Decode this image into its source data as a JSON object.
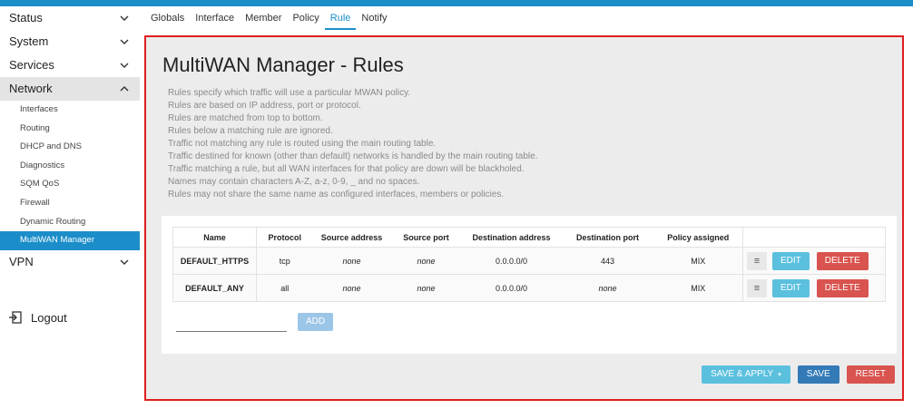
{
  "colors": {
    "accent": "#1b8ec9",
    "highlight_border": "#e01e1e",
    "edit": "#5bc0de",
    "delete": "#d9534f",
    "save": "#337ab7"
  },
  "sidebar": {
    "menus": [
      {
        "label": "Status",
        "icon": "chevron-down-icon"
      },
      {
        "label": "System",
        "icon": "chevron-down-icon"
      },
      {
        "label": "Services",
        "icon": "chevron-down-icon"
      },
      {
        "label": "Network",
        "icon": "chevron-up-icon"
      }
    ],
    "network_items": [
      "Interfaces",
      "Routing",
      "DHCP and DNS",
      "Diagnostics",
      "SQM QoS",
      "Firewall",
      "Dynamic Routing",
      "MultiWAN Manager"
    ],
    "vpn": {
      "label": "VPN",
      "icon": "chevron-down-icon"
    },
    "logout": {
      "label": "Logout",
      "icon": "logout-icon"
    }
  },
  "tabs": [
    "Globals",
    "Interface",
    "Member",
    "Policy",
    "Rule",
    "Notify"
  ],
  "page": {
    "title": "MultiWAN Manager - Rules",
    "description": [
      "Rules specify which traffic will use a particular MWAN policy.",
      "Rules are based on IP address, port or protocol.",
      "Rules are matched from top to bottom.",
      "Rules below a matching rule are ignored.",
      "Traffic not matching any rule is routed using the main routing table.",
      "Traffic destined for known (other than default) networks is handled by the main routing table.",
      "Traffic matching a rule, but all WAN interfaces for that policy are down will be blackholed.",
      "Names may contain characters A-Z, a-z, 0-9, _ and no spaces.",
      "Rules may not share the same name as configured interfaces, members or policies."
    ]
  },
  "table": {
    "headers": [
      "Name",
      "Protocol",
      "Source address",
      "Source port",
      "Destination address",
      "Destination port",
      "Policy assigned"
    ],
    "rows": [
      {
        "name": "DEFAULT_HTTPS",
        "protocol": "tcp",
        "src_addr": "none",
        "src_port": "none",
        "dst_addr": "0.0.0.0/0",
        "dst_port": "443",
        "policy": "MIX"
      },
      {
        "name": "DEFAULT_ANY",
        "protocol": "all",
        "src_addr": "none",
        "src_port": "none",
        "dst_addr": "0.0.0.0/0",
        "dst_port": "none",
        "policy": "MIX"
      }
    ],
    "sort_glyph": "≡",
    "edit_label": "EDIT",
    "delete_label": "DELETE"
  },
  "new_rule": {
    "placeholder": "",
    "add_label": "ADD"
  },
  "footer": {
    "save_apply": "SAVE & APPLY",
    "save": "SAVE",
    "reset": "RESET"
  }
}
